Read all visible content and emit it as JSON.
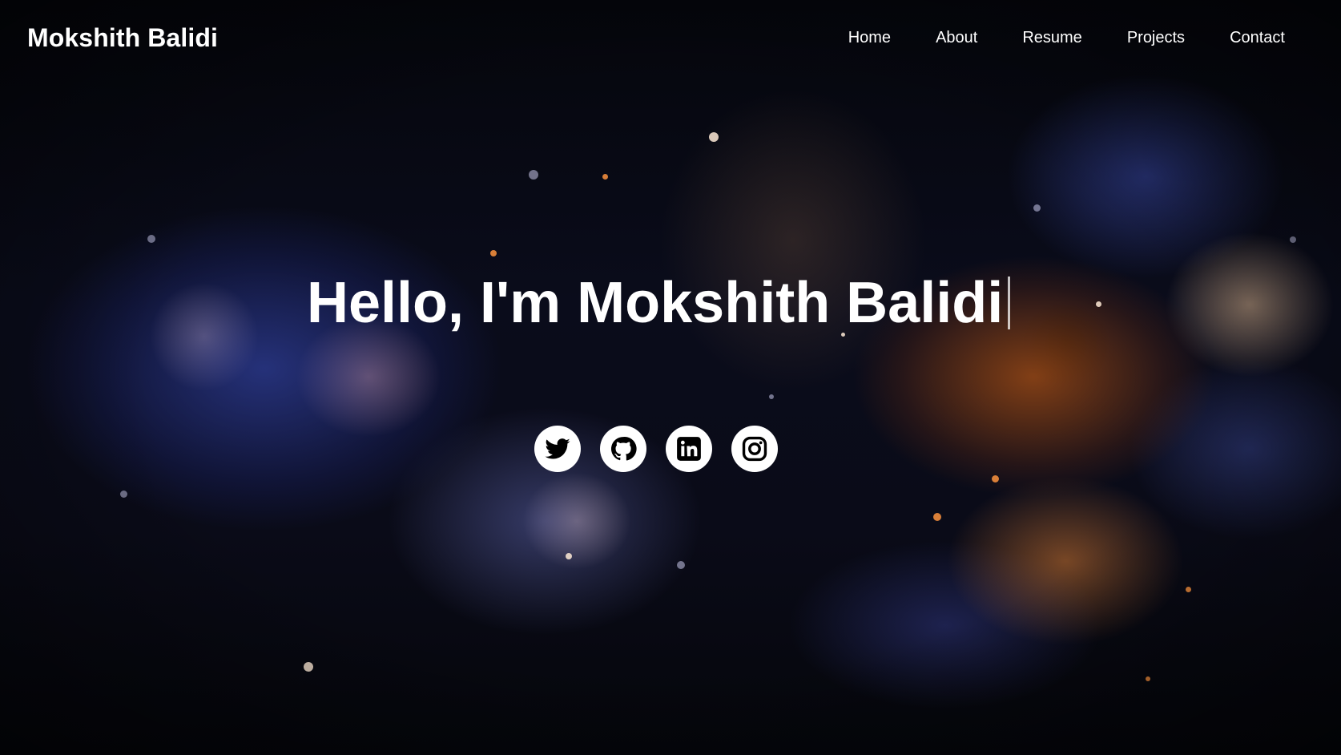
{
  "nav": {
    "brand": "Mokshith Balidi",
    "links": [
      "Home",
      "About",
      "Resume",
      "Projects",
      "Contact"
    ]
  },
  "hero": {
    "headline": "Hello, I'm Mokshith Balidi",
    "socials": [
      {
        "icon": "twitter-icon"
      },
      {
        "icon": "github-icon"
      },
      {
        "icon": "linkedin-icon"
      },
      {
        "icon": "instagram-icon"
      }
    ]
  },
  "colors": {
    "text": "#ffffff",
    "background": "#06070d",
    "icon_fill": "#000000",
    "button_bg": "#ffffff"
  }
}
